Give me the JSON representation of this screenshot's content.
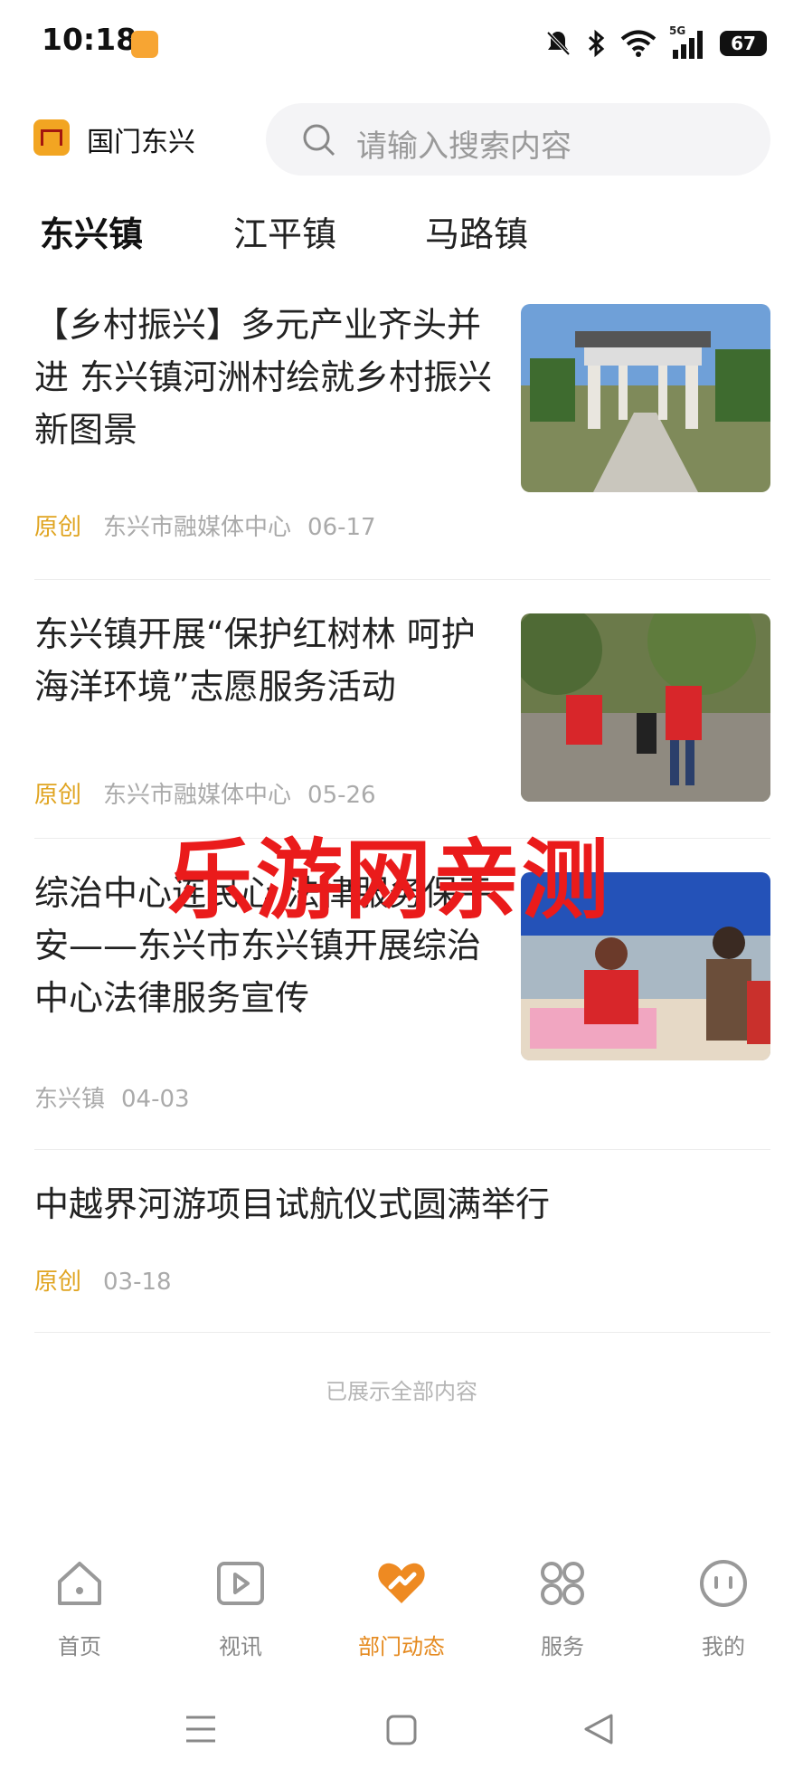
{
  "status": {
    "time": "10:18",
    "battery": "67",
    "network": "5G"
  },
  "header": {
    "app_name": "国门东兴",
    "search_placeholder": "请输入搜索内容"
  },
  "tabs": [
    "东兴镇",
    "江平镇",
    "马路镇"
  ],
  "articles": [
    {
      "title": "【乡村振兴】多元产业齐头并进 东兴镇河洲村绘就乡村振兴新图景",
      "tag": "原创",
      "source": "东兴市融媒体中心",
      "date": "06-17"
    },
    {
      "title": "东兴镇开展“保护红树林 呵护海洋环境”志愿服务活动",
      "tag": "原创",
      "source": "东兴市融媒体中心",
      "date": "05-26"
    },
    {
      "title": "综治中心连民心 法律服务保平安——东兴市东兴镇开展综治中心法律服务宣传",
      "tag": "",
      "source": "东兴镇",
      "date": "04-03"
    },
    {
      "title": "中越界河游项目试航仪式圆满举行",
      "tag": "原创",
      "source": "",
      "date": "03-18"
    }
  ],
  "end_note": "已展示全部内容",
  "watermark": "乐游网亲测",
  "bottom_nav": [
    {
      "label": "首页",
      "icon": "home-icon"
    },
    {
      "label": "视讯",
      "icon": "video-icon"
    },
    {
      "label": "部门动态",
      "icon": "heart-icon",
      "active": true
    },
    {
      "label": "服务",
      "icon": "grid-icon"
    },
    {
      "label": "我的",
      "icon": "face-icon"
    }
  ],
  "colors": {
    "accent": "#e58a1f",
    "tag_original": "#e0a420",
    "watermark": "#ea1b1b"
  }
}
